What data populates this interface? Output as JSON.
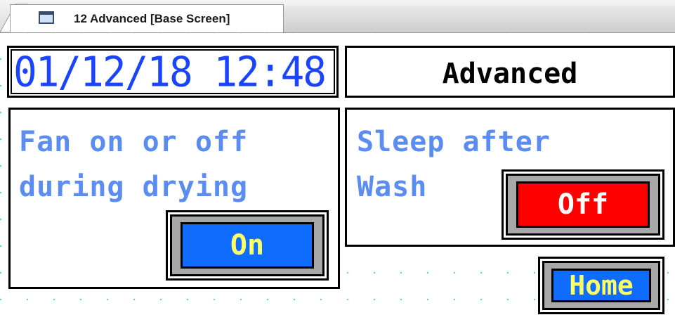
{
  "tab": {
    "title": "12 Advanced [Base Screen]",
    "icon": "screen-icon"
  },
  "screen": {
    "datetime": "01/12/18 12:48",
    "title": "Advanced",
    "fan": {
      "label": "Fan on or off\nduring drying",
      "button_label": "On",
      "button_color": "#0f6cff"
    },
    "sleep": {
      "label": "Sleep after\nWash",
      "button_label": "Off",
      "button_color": "#ff0000"
    },
    "home_button_label": "Home",
    "colors": {
      "clock_text": "#1a44ff",
      "label_text": "#5a8cf2",
      "button_text": "#ffff66",
      "grid_dot": "#66d0d8"
    }
  }
}
